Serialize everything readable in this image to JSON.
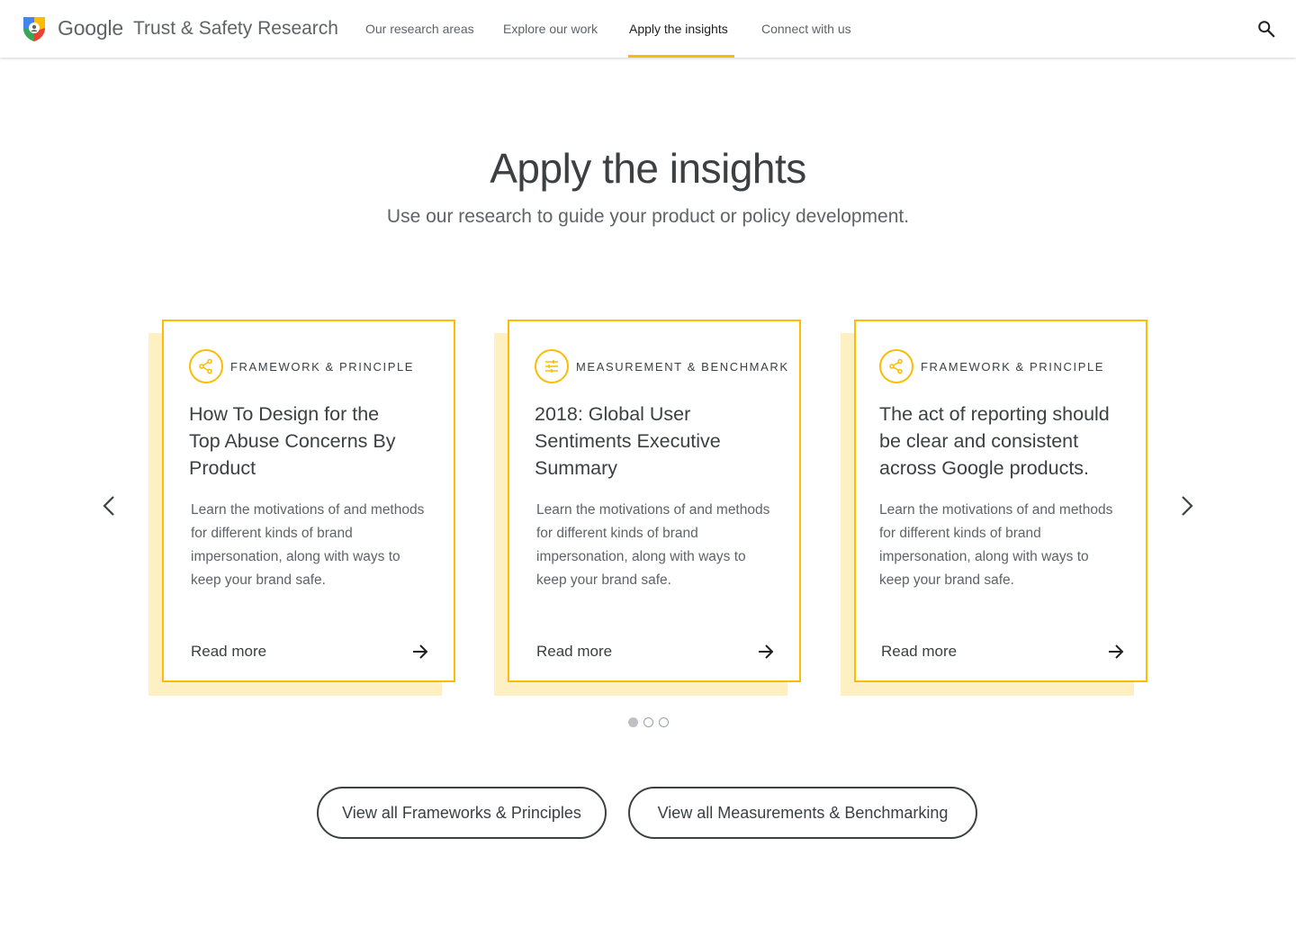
{
  "header": {
    "brand_google": "Google",
    "brand_name": "Trust & Safety Research",
    "nav": [
      {
        "label": "Our research areas"
      },
      {
        "label": "Explore our work"
      },
      {
        "label": "Apply the insights",
        "active": true
      },
      {
        "label": "Connect with us"
      }
    ],
    "search_icon": "search-icon"
  },
  "hero": {
    "title": "Apply the insights",
    "subtitle": "Use our research to guide your product or policy development."
  },
  "carousel": {
    "cards": [
      {
        "category": "FRAMEWORK & PRINCIPLE",
        "category_icon": "share-icon",
        "title": "How To Design for the Top Abuse Concerns By Product",
        "description": "Learn the motivations of and methods for different kinds of brand impersonation, along with ways to keep your brand safe.",
        "link_label": "Read more"
      },
      {
        "category": "MEASUREMENT & BENCHMARK",
        "category_icon": "tune-icon",
        "title": "2018: Global User Sentiments Executive Summary",
        "description": "Learn the motivations of and methods for different kinds of brand impersonation, along with ways to keep your brand safe.",
        "link_label": "Read more"
      },
      {
        "category": "FRAMEWORK & PRINCIPLE",
        "category_icon": "share-icon",
        "title": "The act of reporting should be clear and consistent across Google products.",
        "description": "Learn the motivations of and methods for different kinds of brand impersonation, along with ways to keep your brand safe.",
        "link_label": "Read more"
      }
    ],
    "page_count": 3,
    "active_page": 1
  },
  "buttons": {
    "frameworks": "View all Frameworks & Principles",
    "measurements": "View all Measurements & Benchmarking"
  },
  "colors": {
    "accent": "#fbbc04",
    "card_shadow": "#fef0c3",
    "text": "#3c4043",
    "muted": "#5f6368"
  }
}
